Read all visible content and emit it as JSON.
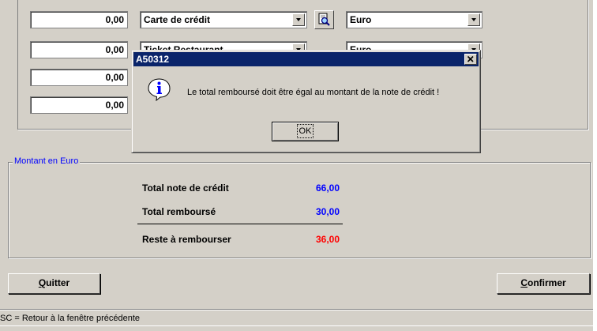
{
  "payments": [
    {
      "amount": "0,00",
      "method": "Carte de crédit",
      "currency": "Euro"
    },
    {
      "amount": "0,00",
      "method": "Ticket Restaurant",
      "currency": "Euro"
    },
    {
      "amount": "0,00"
    },
    {
      "amount": "0,00"
    }
  ],
  "summary": {
    "legend": "Montant en Euro",
    "total_note_label": "Total note de crédit",
    "total_note_value": "66,00",
    "total_rembourse_label": "Total remboursé",
    "total_rembourse_value": "30,00",
    "reste_label": "Reste à rembourser",
    "reste_value": "36,00"
  },
  "buttons": {
    "quit": "Quitter",
    "confirm": "Confirmer"
  },
  "status_bar": "SC = Retour à la fenêtre précédente",
  "dialog": {
    "title": "A50312",
    "message": "Le total remboursé doit être égal au montant de la note de crédit !",
    "ok_label": "OK",
    "icon": "info-icon"
  },
  "colors": {
    "title_bar": "#0a246a",
    "window_face": "#d4d0c8",
    "value_blue": "#0000ff",
    "value_red": "#ff0000"
  }
}
